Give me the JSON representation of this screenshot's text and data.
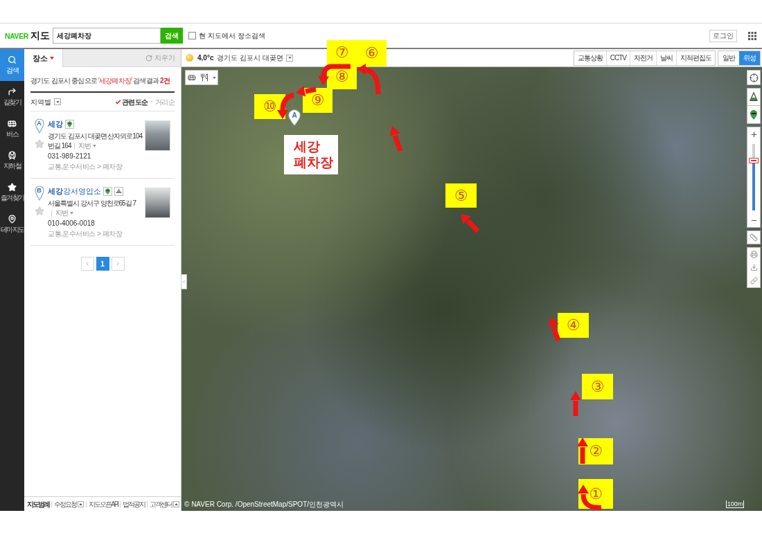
{
  "header": {
    "logo": {
      "brand": "NAVER",
      "service": "지도"
    },
    "search": {
      "value": "세강폐차장",
      "button": "검색"
    },
    "area_search": {
      "label": "현 지도에서 장소검색",
      "checked": false
    },
    "login": "로그인"
  },
  "nav": [
    {
      "label": "검색",
      "selected": true
    },
    {
      "label": "길찾기",
      "selected": false
    },
    {
      "label": "버스",
      "selected": false
    },
    {
      "label": "지하철",
      "selected": false
    },
    {
      "label": "즐겨찾기",
      "selected": false
    },
    {
      "label": "테마지도",
      "selected": false
    }
  ],
  "panel": {
    "tabs": [
      {
        "label": "장소",
        "selected": true
      }
    ],
    "clear": "지우기",
    "summary": {
      "prefix": "경기도 김포시 중심으로",
      "query": "'세강폐차장'",
      "suffix": "검색결과",
      "count": "2건"
    },
    "filter": "지역별",
    "sort": [
      {
        "label": "관련도순",
        "selected": true
      },
      {
        "label": "거리순",
        "selected": false
      }
    ],
    "results": [
      {
        "marker": "A",
        "name": {
          "highlight": "세강"
        },
        "icons": [
          {
            "kind": "pin"
          }
        ],
        "address": "경기도 김포시 대곶면 산자뫼로104번길 164",
        "jibun": "지번",
        "phone": "031-989-2121",
        "category": "교통,운수서비스 > 폐차장"
      },
      {
        "marker": "B",
        "name": {
          "highlight": "세강",
          "rest": "강서영업소"
        },
        "icons": [
          {
            "kind": "pin"
          },
          {
            "kind": "cone"
          }
        ],
        "address": "서울특별시 강서구 양천로65길 7",
        "jibun": "지번",
        "phone": "010-4006-0018",
        "category": "교통,운수서비스 > 폐차장"
      }
    ],
    "pages": [
      {
        "label": "1",
        "selected": true
      }
    ],
    "footer": [
      {
        "label": "지도범례",
        "kind": "legend"
      },
      {
        "label": "수정요청",
        "kind": "menu"
      },
      {
        "label": "지도오픈API",
        "kind": "link"
      },
      {
        "label": "법적공지",
        "kind": "link"
      },
      {
        "label": "고객센터",
        "kind": "menu"
      }
    ]
  },
  "map": {
    "weather": {
      "temperature": "4,0°c",
      "location": "경기도 김포시 대곶면"
    },
    "layers": [
      {
        "label": "교통상황",
        "on": false
      },
      {
        "label": "CCTV",
        "on": false
      },
      {
        "label": "자전거",
        "on": false
      },
      {
        "label": "날씨",
        "on": false
      },
      {
        "label": "지적편집도",
        "on": false
      }
    ],
    "map_types": [
      {
        "label": "일반",
        "selected": false
      },
      {
        "label": "위성",
        "selected": true
      }
    ],
    "zoom": {
      "level": 0.75
    },
    "marker": {
      "label": "A"
    },
    "annotations": {
      "steps": [
        {
          "label": "⑦"
        },
        {
          "label": "⑥"
        },
        {
          "label": "⑧"
        },
        {
          "label": "⑨"
        },
        {
          "label": "⑩"
        },
        {
          "label": "⑤"
        },
        {
          "label": "④"
        },
        {
          "label": "③"
        },
        {
          "label": "②"
        },
        {
          "label": "①"
        }
      ],
      "callout": "세강 폐차장"
    },
    "copyright": "© NAVER Corp. /OpenStreetMap/SPOT/인천광역시",
    "scale": "100m"
  }
}
